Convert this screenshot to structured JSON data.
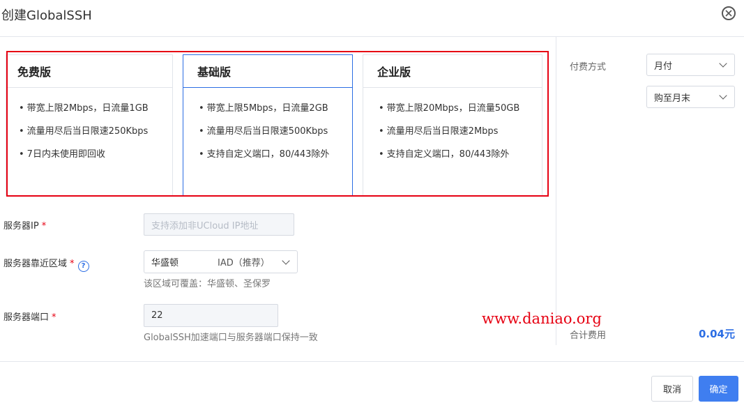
{
  "dialog": {
    "title": "创建GlobalSSH"
  },
  "plans": [
    {
      "name": "免费版",
      "features": [
        "带宽上限2Mbps，日流量1GB",
        "流量用尽后当日限速250Kbps",
        "7日内未使用即回收"
      ]
    },
    {
      "name": "基础版",
      "features": [
        "带宽上限5Mbps，日流量2GB",
        "流量用尽后当日限速500Kbps",
        "支持自定义端口，80/443除外"
      ]
    },
    {
      "name": "企业版",
      "features": [
        "带宽上限20Mbps，日流量50GB",
        "流量用尽后当日限速2Mbps",
        "支持自定义端口，80/443除外"
      ]
    }
  ],
  "selected_plan": "基础版",
  "form": {
    "server_ip": {
      "label": "服务器IP",
      "required": "*",
      "placeholder": "支持添加非UCloud IP地址",
      "value": ""
    },
    "region": {
      "label": "服务器靠近区域",
      "required": "*",
      "help": "?",
      "city": "华盛顿",
      "code": "IAD（推荐）",
      "hint": "该区域可覆盖：华盛顿、圣保罗"
    },
    "port": {
      "label": "服务器端口",
      "required": "*",
      "value": "22",
      "hint": "GlobalSSH加速端口与服务器端口保持一致"
    }
  },
  "billing": {
    "method_label": "付费方式",
    "method_value": "月付",
    "duration_value": "购至月末",
    "total_label": "合计费用",
    "total_value": "0.04元"
  },
  "watermark": "www.daniao.org",
  "buttons": {
    "cancel": "取消",
    "confirm": "确定"
  },
  "colors": {
    "accent": "#2b6de4",
    "highlight": "#e60012",
    "primary_button": "#3f7ef0"
  }
}
